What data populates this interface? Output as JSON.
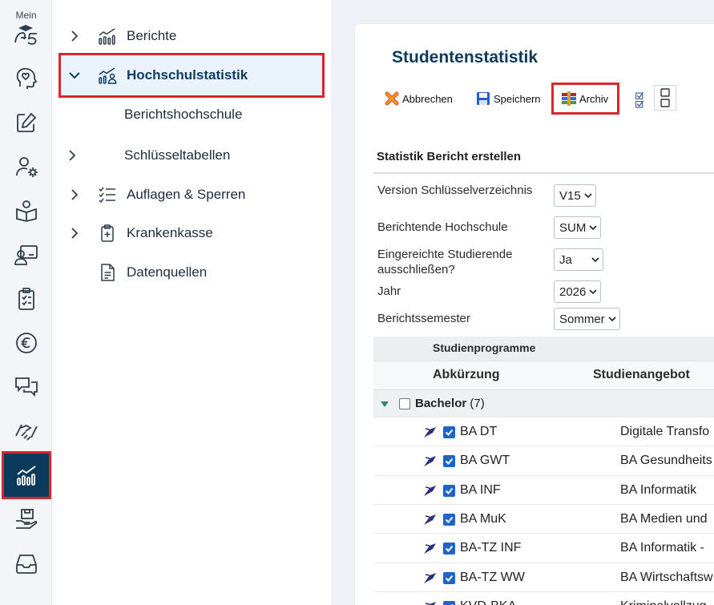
{
  "rail": {
    "mein_label": "Mein",
    "icons": [
      "mein-a5-logo",
      "head-heart-icon",
      "edit-icon",
      "user-settings-icon",
      "reader-icon",
      "presentation-icon",
      "clipboard-checklist-icon",
      "euro-icon",
      "chat-icon",
      "handshake-icon",
      "statistics-icon",
      "hand-box-icon",
      "inbox-icon"
    ],
    "active": "statistics-icon"
  },
  "tree": {
    "items": [
      {
        "label": "Berichte"
      },
      {
        "label": "Hochschulstatistik"
      },
      {
        "label": "Berichtshochschule"
      },
      {
        "label": "Schlüsseltabellen"
      },
      {
        "label": "Auflagen & Sperren"
      },
      {
        "label": "Krankenkasse"
      },
      {
        "label": "Datenquellen"
      }
    ]
  },
  "main": {
    "title": "Studentenstatistik",
    "toolbar": {
      "abbrechen": "Abbrechen",
      "speichern": "Speichern",
      "archiv": "Archiv"
    },
    "section_title": "Statistik Bericht erstellen",
    "form": {
      "version_label": "Version Schlüsselverzeichnis",
      "version_value": "V15",
      "hochschule_label": "Berichtende Hochschule",
      "hochschule_value": "SUM",
      "exclude_label": "Eingereichte Studierende ausschließen?",
      "exclude_value": "Ja",
      "jahr_label": "Jahr",
      "jahr_value": "2026",
      "semester_label": "Berichtssemester",
      "semester_value": "Sommer"
    },
    "table": {
      "group_header": "Studienprogramme",
      "col_abk": "Abkürzung",
      "col_angebot": "Studienangebot",
      "group_name": "Bachelor",
      "group_count": "(7)",
      "rows": [
        {
          "abk": "BA DT",
          "angebot": "Digitale Transfo"
        },
        {
          "abk": "BA GWT",
          "angebot": "BA Gesundheits"
        },
        {
          "abk": "BA INF",
          "angebot": "BA Informatik"
        },
        {
          "abk": "BA MuK",
          "angebot": "BA Medien und"
        },
        {
          "abk": "BA-TZ INF",
          "angebot": "BA Informatik -"
        },
        {
          "abk": "BA-TZ WW",
          "angebot": "BA Wirtschaftsw"
        },
        {
          "abk": "KVD-BKA",
          "angebot": "Kriminalvollzug"
        }
      ]
    }
  },
  "colors": {
    "accent_dark": "#0c3a5c",
    "highlight_red": "#d9262c",
    "checkbox_blue": "#1d65c9"
  }
}
